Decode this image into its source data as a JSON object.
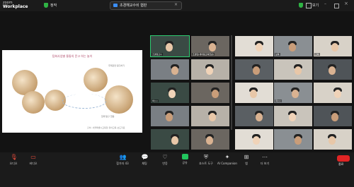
{
  "app": {
    "brand_top": "zoom",
    "brand_bottom": "Workplace"
  },
  "topbar": {
    "shield_label": "정작",
    "meeting_title": "초경해교수비 협판",
    "view_label": "보기"
  },
  "slide": {
    "title": "탐회사업별 통통의 문고 하는 놀이",
    "captions": [
      "주제관련 탐구하기",
      "함께 탐구 협동",
      "출처: 서울특별시교육청 유아교육 보도자료"
    ]
  },
  "participants": [
    {
      "name": "조경원교수",
      "active": true
    },
    {
      "name": "조경란(세아동교육전공)"
    },
    {
      "name": ""
    },
    {
      "name": "보육"
    },
    {
      "name": "교육"
    },
    {
      "name": ""
    },
    {
      "name": ""
    },
    {
      "name": ""
    },
    {
      "name": ""
    },
    {
      "name": ""
    },
    {
      "name": "박○○"
    },
    {
      "name": ""
    },
    {
      "name": ""
    },
    {
      "name": "최○○"
    },
    {
      "name": ""
    },
    {
      "name": ""
    },
    {
      "name": ""
    },
    {
      "name": ""
    },
    {
      "name": ""
    },
    {
      "name": ""
    },
    {
      "name": ""
    },
    {
      "name": ""
    },
    {
      "name": ""
    },
    {
      "name": ""
    },
    {
      "name": ""
    }
  ],
  "toolbar": {
    "audio": "오디오",
    "video": "비디오",
    "participants": "참가자",
    "participants_count": "43",
    "chat": "채팅",
    "react": "반응",
    "share": "공유",
    "host_tools": "호스트 도구",
    "ai": "AI Companion",
    "apps": "앱",
    "more": "더 보기",
    "end": "종료"
  },
  "colors": {
    "active_speaker": "#2ecc71",
    "end": "#e02424",
    "share": "#22c55e"
  }
}
